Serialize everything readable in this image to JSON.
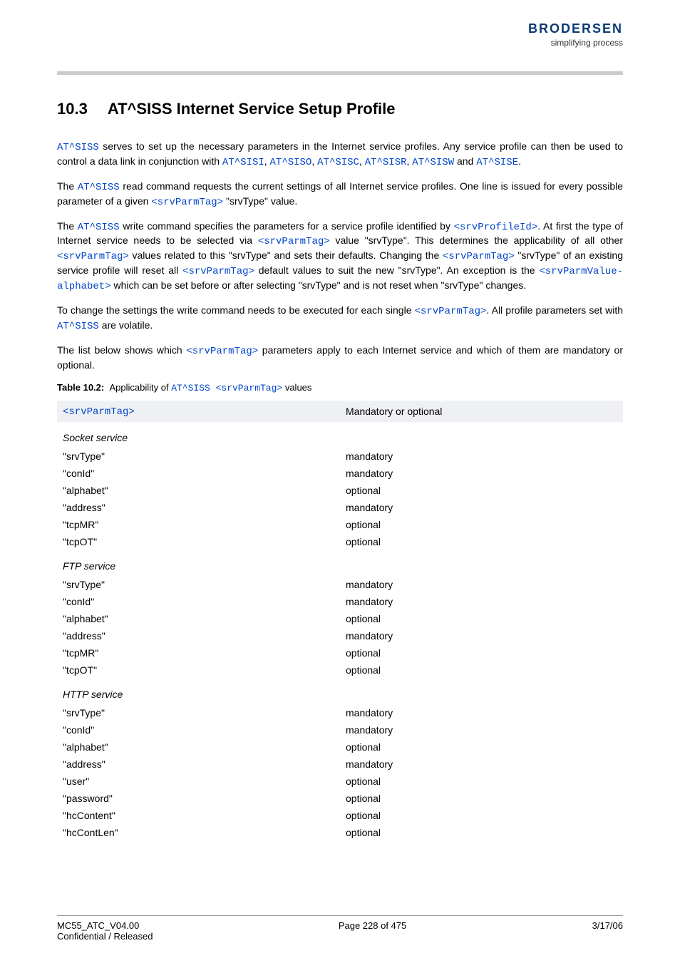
{
  "logo": {
    "brand": "BRODERSEN",
    "tagline": "simplifying process"
  },
  "heading": {
    "number": "10.3",
    "title": "AT^SISS   Internet Service Setup Profile"
  },
  "para1": {
    "t1": "AT^SISS",
    "t2": " serves to set up the necessary parameters in the Internet service profiles. Any service profile can then be used to control a data link in conjunction with ",
    "c1": "AT^SISI",
    "s1": ", ",
    "c2": "AT^SISO",
    "s2": ", ",
    "c3": "AT^SISC",
    "s3": ", ",
    "c4": "AT^SISR",
    "s4": ", ",
    "c5": "AT^SISW",
    "s5": " and ",
    "c6": "AT^SISE",
    "s6": "."
  },
  "para2": {
    "t1": "The ",
    "c1": "AT^SISS",
    "t2": " read command requests the current settings of all Internet service profiles. One line is issued for every possible parameter of a given ",
    "c2": "<srvParmTag>",
    "t3": " \"srvType\" value."
  },
  "para3": {
    "t1": "The ",
    "c1": "AT^SISS",
    "t2": " write command specifies the parameters for a service profile identified by ",
    "c2": "<srvProfileId>",
    "t3": ". At first the type of Internet service needs to be selected via ",
    "c3": "<srvParmTag>",
    "t4": " value \"srvType\". This determines the applicability of all other ",
    "c4": "<srvParmTag>",
    "t5": " values related to this \"srvType\" and sets their defaults. Changing the ",
    "c5": "<srvParmTag>",
    "t6": " \"srvType\" of an existing service profile will reset all ",
    "c6": "<srvParmTag>",
    "t7": " default values to suit the new \"srvType\". An exception is the ",
    "c7": "<srvParmValue-alphabet>",
    "t8": " which can be set before or after selecting \"srvType\" and is not reset when \"srvType\" changes."
  },
  "para4": {
    "t1": "To change the settings the write command needs to be executed for each single ",
    "c1": "<srvParmTag>",
    "t2": ". All profile parameters set with ",
    "c2": "AT^SISS",
    "t3": " are volatile."
  },
  "para5": {
    "t1": "The list below shows which ",
    "c1": "<srvParmTag>",
    "t2": " parameters apply to each Internet service and which of them are mandatory or optional."
  },
  "table_caption": {
    "label": "Table 10.2:",
    "pre": "Applicability of ",
    "cmd": "AT^SISS <srvParmTag>",
    "post": " values"
  },
  "table": {
    "headers": {
      "col1": "<srvParmTag>",
      "col2": "Mandatory or optional"
    },
    "groups": [
      {
        "title": "Socket service",
        "rows": [
          {
            "tag": "\"srvType\"",
            "req": "mandatory"
          },
          {
            "tag": "\"conId\"",
            "req": "mandatory"
          },
          {
            "tag": "\"alphabet\"",
            "req": "optional"
          },
          {
            "tag": "\"address\"",
            "req": "mandatory"
          },
          {
            "tag": "\"tcpMR\"",
            "req": "optional"
          },
          {
            "tag": "\"tcpOT\"",
            "req": "optional"
          }
        ]
      },
      {
        "title": "FTP service",
        "rows": [
          {
            "tag": "\"srvType\"",
            "req": "mandatory"
          },
          {
            "tag": "\"conId\"",
            "req": "mandatory"
          },
          {
            "tag": "\"alphabet\"",
            "req": "optional"
          },
          {
            "tag": "\"address\"",
            "req": "mandatory"
          },
          {
            "tag": "\"tcpMR\"",
            "req": "optional"
          },
          {
            "tag": "\"tcpOT\"",
            "req": "optional"
          }
        ]
      },
      {
        "title": "HTTP service",
        "rows": [
          {
            "tag": "\"srvType\"",
            "req": "mandatory"
          },
          {
            "tag": "\"conId\"",
            "req": "mandatory"
          },
          {
            "tag": "\"alphabet\"",
            "req": "optional"
          },
          {
            "tag": "\"address\"",
            "req": "mandatory"
          },
          {
            "tag": "\"user\"",
            "req": "optional"
          },
          {
            "tag": "\"password\"",
            "req": "optional"
          },
          {
            "tag": "\"hcContent\"",
            "req": "optional"
          },
          {
            "tag": "\"hcContLen\"",
            "req": "optional"
          }
        ]
      }
    ]
  },
  "footer": {
    "doc_id": "MC55_ATC_V04.00",
    "conf": "Confidential / Released",
    "page": "Page 228 of 475",
    "date": "3/17/06"
  }
}
